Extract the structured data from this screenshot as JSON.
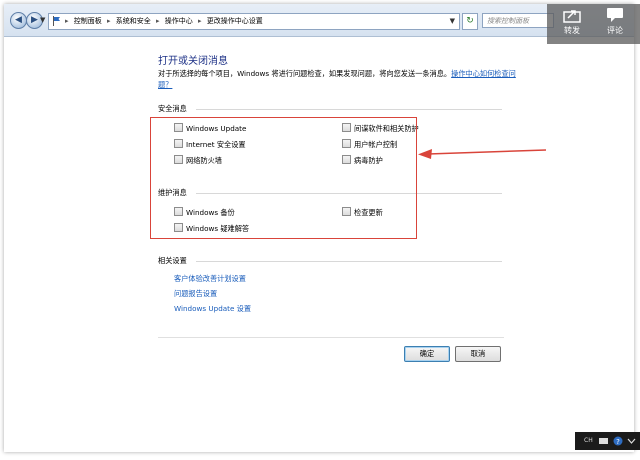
{
  "nav": {
    "breadcrumbs": [
      "控制面板",
      "系统和安全",
      "操作中心",
      "更改操作中心设置"
    ],
    "search_placeholder": "搜索控制面板"
  },
  "overlay": {
    "share_label": "转发",
    "comment_label": "评论"
  },
  "page": {
    "title": "打开或关闭消息",
    "description": "对于所选择的每个项目，Windows 将进行问题检查，如果发现问题，将向您发送一条消息。",
    "description_link": "操作中心如何检查问题？"
  },
  "security": {
    "title": "安全消息",
    "items": [
      {
        "label": "Windows Update",
        "checked": false
      },
      {
        "label": "Internet 安全设置",
        "checked": false
      },
      {
        "label": "网络防火墙",
        "checked": false
      },
      {
        "label": "间谍软件和相关防护",
        "checked": false
      },
      {
        "label": "用户帐户控制",
        "checked": false
      },
      {
        "label": "病毒防护",
        "checked": false
      }
    ]
  },
  "maintenance": {
    "title": "维护消息",
    "items": [
      {
        "label": "Windows 备份",
        "checked": false
      },
      {
        "label": "Windows 疑难解答",
        "checked": false
      },
      {
        "label": "检查更新",
        "checked": false
      }
    ]
  },
  "related": {
    "title": "相关设置",
    "links": [
      "客户体验改善计划设置",
      "问题报告设置",
      "Windows Update 设置"
    ]
  },
  "buttons": {
    "ok": "确定",
    "cancel": "取消"
  },
  "taskbar": {
    "ch": "CH"
  },
  "colors": {
    "link": "#1a5dbb",
    "title": "#1e3287",
    "annotation": "#d9443a"
  }
}
